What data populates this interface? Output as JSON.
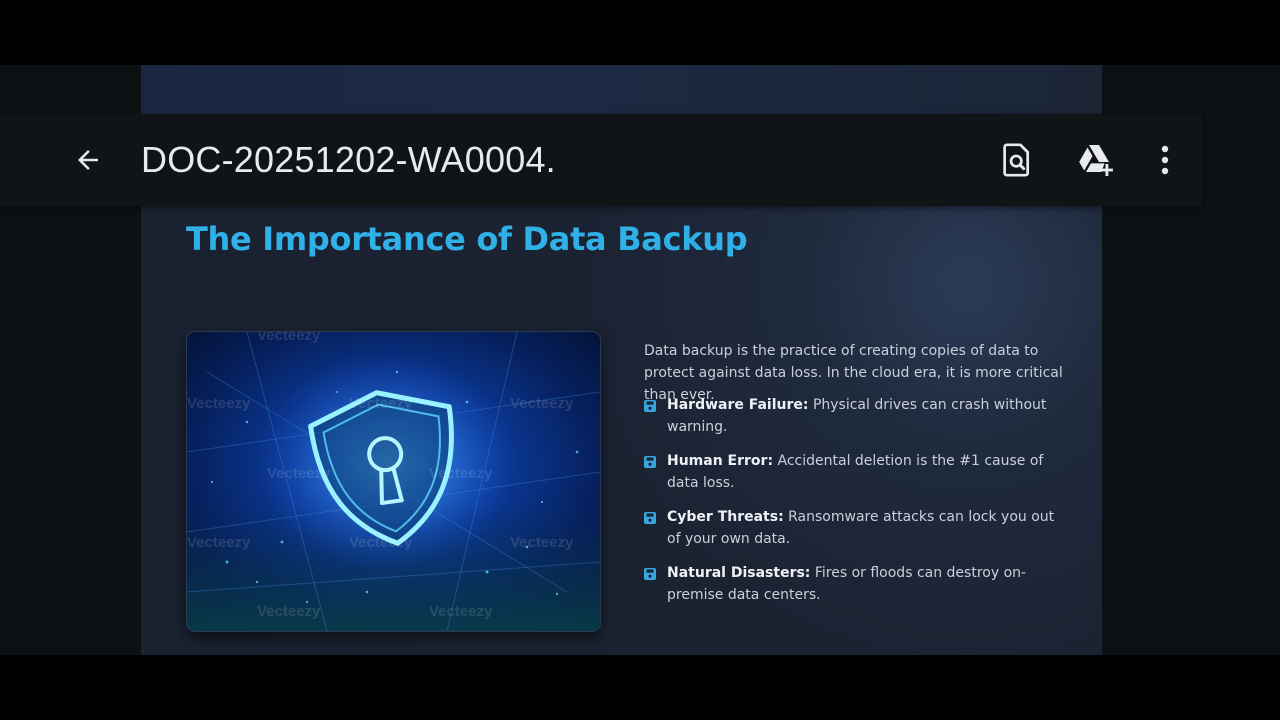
{
  "app_bar": {
    "back_label": "Back",
    "document_title": "DOC-20251202-WA0004.",
    "actions": [
      {
        "icon": "find-in-page-icon",
        "label": "Search in document"
      },
      {
        "icon": "google-drive-add-icon",
        "label": "Save to Drive"
      },
      {
        "icon": "more-vert-icon",
        "label": "More options"
      }
    ]
  },
  "slide": {
    "title": "The Importance of Data Backup",
    "image": {
      "subject": "glowing shield with keyhole on dark blue digital background",
      "watermark": "Vecteezy"
    },
    "intro": "Data backup is the practice of creating copies of data to protect against data loss. In the cloud era, it is more critical than ever.",
    "bullets": [
      {
        "icon": "save-icon",
        "heading": "Hardware Failure:",
        "text": " Physical drives can crash without warning."
      },
      {
        "icon": "save-icon",
        "heading": "Human Error:",
        "text": " Accidental deletion is the #1 cause of data loss."
      },
      {
        "icon": "save-icon",
        "heading": "Cyber Threats:",
        "text": " Ransomware attacks can lock you out of your own data."
      },
      {
        "icon": "save-icon",
        "heading": "Natural Disasters:",
        "text": " Fires or floods can destroy on-premise data centers."
      }
    ]
  },
  "colors": {
    "title_accent": "#2fb1e8",
    "bullet_icon": "#3aa6e0",
    "app_bar": "#111417",
    "slide_bg": "#1b2333"
  }
}
